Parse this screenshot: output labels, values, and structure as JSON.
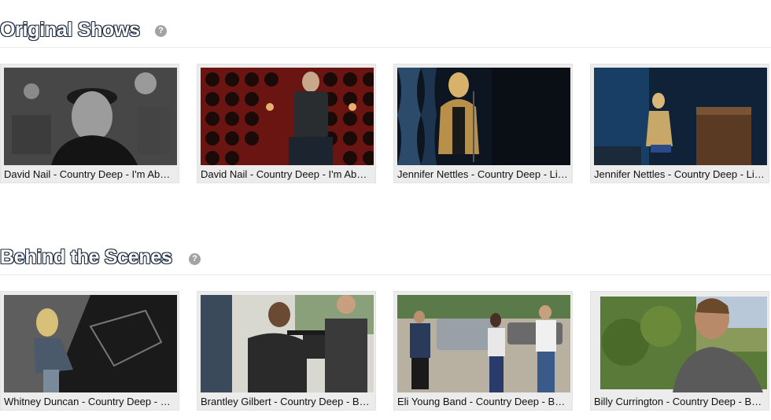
{
  "sections": [
    {
      "title": "Original Shows",
      "help": "?",
      "videos": [
        {
          "title": "David Nail - Country Deep - I'm About to Come Alive"
        },
        {
          "title": "David Nail - Country Deep - I'm About to Come Alive"
        },
        {
          "title": "Jennifer Nettles - Country Deep - Live Performance"
        },
        {
          "title": "Jennifer Nettles - Country Deep - Live Performance"
        }
      ]
    },
    {
      "title": "Behind the Scenes",
      "help": "?",
      "videos": [
        {
          "title": "Whitney Duncan - Country Deep - Behind the Scenes"
        },
        {
          "title": "Brantley Gilbert - Country Deep - Behind the Scenes"
        },
        {
          "title": "Eli Young Band - Country Deep - Behind the Scenes"
        },
        {
          "title": "Billy Currington - Country Deep - Behind the Scenes"
        }
      ]
    }
  ]
}
